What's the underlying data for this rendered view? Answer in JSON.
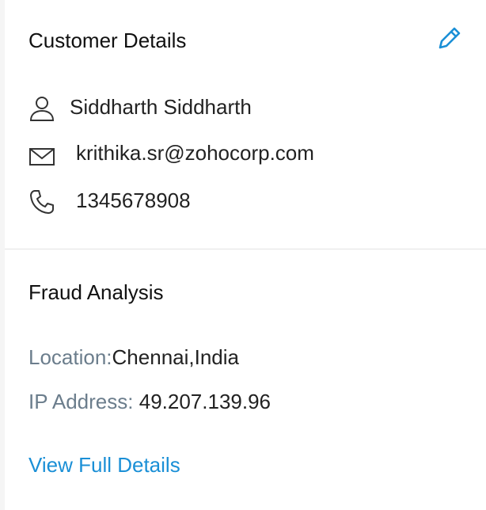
{
  "customer_details": {
    "title": "Customer Details",
    "name": "Siddharth Siddharth",
    "email": "krithika.sr@zohocorp.com",
    "phone": "1345678908"
  },
  "fraud_analysis": {
    "title": "Fraud Analysis",
    "location_label": "Location:",
    "location_value": "Chennai,India",
    "ip_label": "IP Address:",
    "ip_value": "49.207.139.96",
    "view_link": "View Full Details"
  },
  "icons": {
    "edit": "pencil-icon",
    "name": "user-icon",
    "email": "mail-icon",
    "phone": "phone-icon"
  },
  "colors": {
    "accent": "#1a8fd6",
    "label": "#6b7d8c",
    "text": "#222222"
  }
}
